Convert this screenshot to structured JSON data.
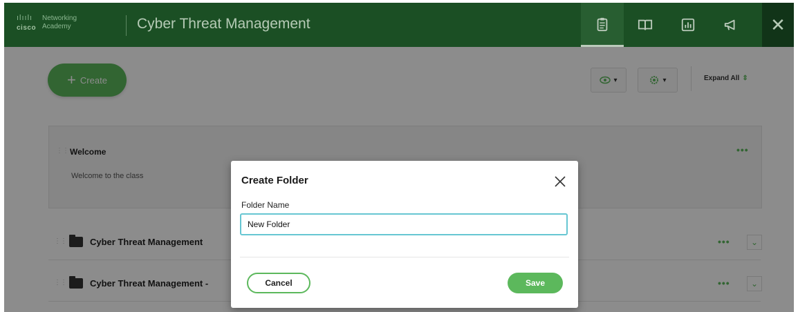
{
  "header": {
    "logo_brand": "cisco",
    "logo_sub": "Networking Academy",
    "logo_bars": "ılıılı",
    "app_title": "Cyber Threat Management",
    "icons": [
      "clipboard-icon",
      "book-icon",
      "chart-icon",
      "megaphone-icon"
    ],
    "close_glyph": "✕"
  },
  "toolbar": {
    "create_label": "Create",
    "create_glyph": "+",
    "visibility_icon": "eye-icon",
    "settings_icon": "gear-icon",
    "caret": "▾",
    "expand_all_label": "Expand All",
    "expand_glyph": "⇕"
  },
  "welcome": {
    "title": "Welcome",
    "text": "Welcome to the class",
    "more": "•••"
  },
  "rows": [
    {
      "title": "Cyber Threat Management",
      "more": "•••",
      "chevron": "⌄"
    },
    {
      "title": "Cyber Threat Management -",
      "more": "•••",
      "chevron": "⌄"
    }
  ],
  "modal": {
    "title": "Create Folder",
    "close_glyph": "✕",
    "field_label": "Folder Name",
    "field_value": "New Folder",
    "cancel_label": "Cancel",
    "save_label": "Save"
  },
  "colors": {
    "header_bg": "#1f5b2a",
    "accent_green": "#5cb85c",
    "input_focus": "#66c6d2"
  }
}
